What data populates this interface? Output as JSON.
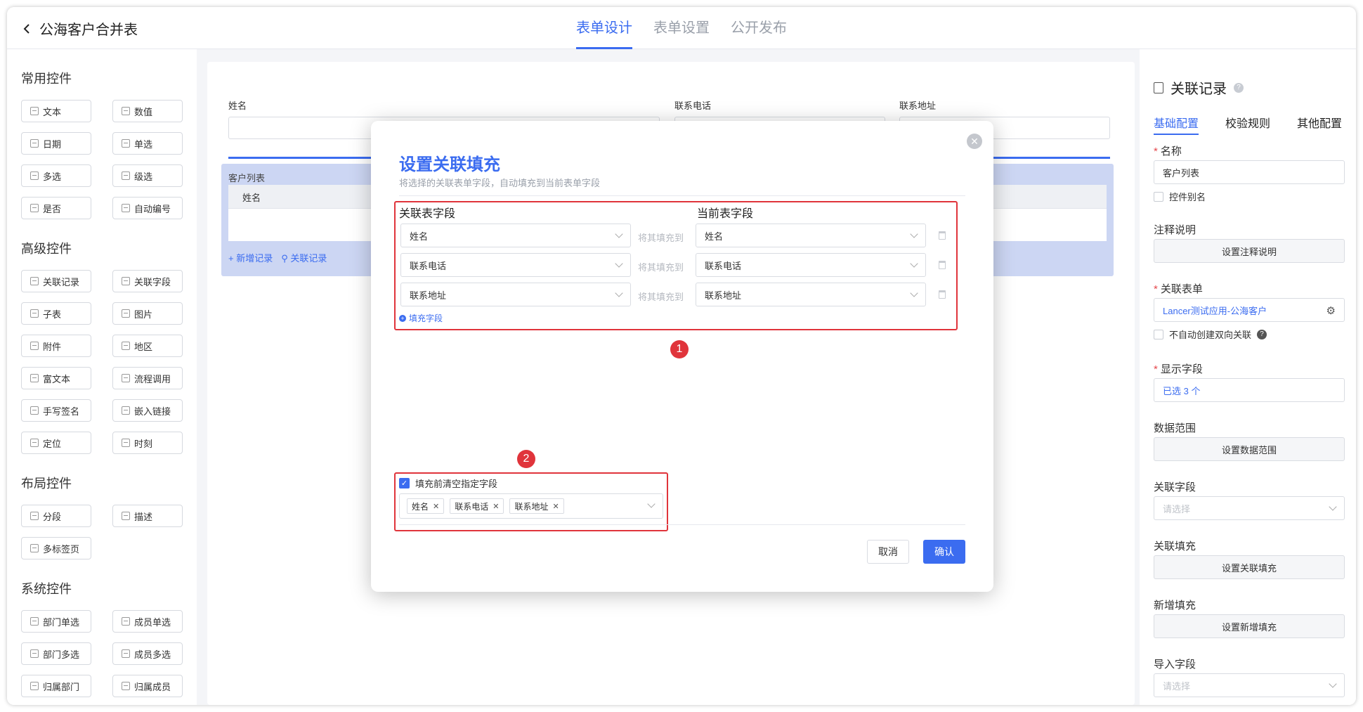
{
  "header": {
    "title": "公海客户合并表",
    "tabs": [
      {
        "label": "表单设计"
      },
      {
        "label": "表单设置"
      },
      {
        "label": "公开发布"
      }
    ]
  },
  "left": {
    "sections": [
      {
        "title": "常用控件",
        "items": [
          "文本",
          "数值",
          "日期",
          "单选",
          "多选",
          "级选",
          "是否",
          "自动编号"
        ]
      },
      {
        "title": "高级控件",
        "items": [
          "关联记录",
          "关联字段",
          "子表",
          "图片",
          "附件",
          "地区",
          "富文本",
          "流程调用",
          "手写签名",
          "嵌入链接",
          "定位",
          "时刻"
        ]
      },
      {
        "title": "布局控件",
        "items": [
          "分段",
          "描述",
          "多标签页"
        ]
      },
      {
        "title": "系统控件",
        "items": [
          "部门单选",
          "成员单选",
          "部门多选",
          "成员多选",
          "归属部门",
          "归属成员"
        ]
      }
    ]
  },
  "canvas": {
    "fields": {
      "name": "姓名",
      "phone": "联系电话",
      "address": "联系地址"
    },
    "subtable": {
      "title": "客户列表",
      "column": "姓名",
      "add_record": "新增记录",
      "link_record": "关联记录"
    }
  },
  "right": {
    "title": "关联记录",
    "tabs": [
      "基础配置",
      "校验规则",
      "其他配置"
    ],
    "name_label": "名称",
    "name_value": "客户列表",
    "alias_label": "控件别名",
    "note_label": "注释说明",
    "note_button": "设置注释说明",
    "link_form_label": "关联表单",
    "link_form_value": "Lancer测试应用-公海客户",
    "no_bidir_label": "不自动创建双向关联",
    "display_label": "显示字段",
    "display_value": "已选 3 个",
    "range_label": "数据范围",
    "range_button": "设置数据范围",
    "link_field_label": "关联字段",
    "link_field_placeholder": "请选择",
    "link_fill_label": "关联填充",
    "link_fill_button": "设置关联填充",
    "new_fill_label": "新增填充",
    "new_fill_button": "设置新增填充",
    "import_label": "导入字段",
    "import_placeholder": "请选择"
  },
  "modal": {
    "title": "设置关联填充",
    "subtitle": "将选择的关联表单字段，自动填充到当前表单字段",
    "col_left": "关联表字段",
    "col_right": "当前表字段",
    "fill_to": "将其填充到",
    "rows": [
      {
        "left": "姓名",
        "right": "姓名"
      },
      {
        "left": "联系电话",
        "right": "联系电话"
      },
      {
        "left": "联系地址",
        "right": "联系地址"
      }
    ],
    "add_field": "填充字段",
    "badge1": "1",
    "badge2": "2",
    "clear_label": "填充前清空指定字段",
    "tags": [
      "姓名",
      "联系电话",
      "联系地址"
    ],
    "cancel": "取消",
    "confirm": "确认"
  },
  "colors": {
    "accent": "#3b6cf0",
    "annotation": "#e0343b"
  }
}
